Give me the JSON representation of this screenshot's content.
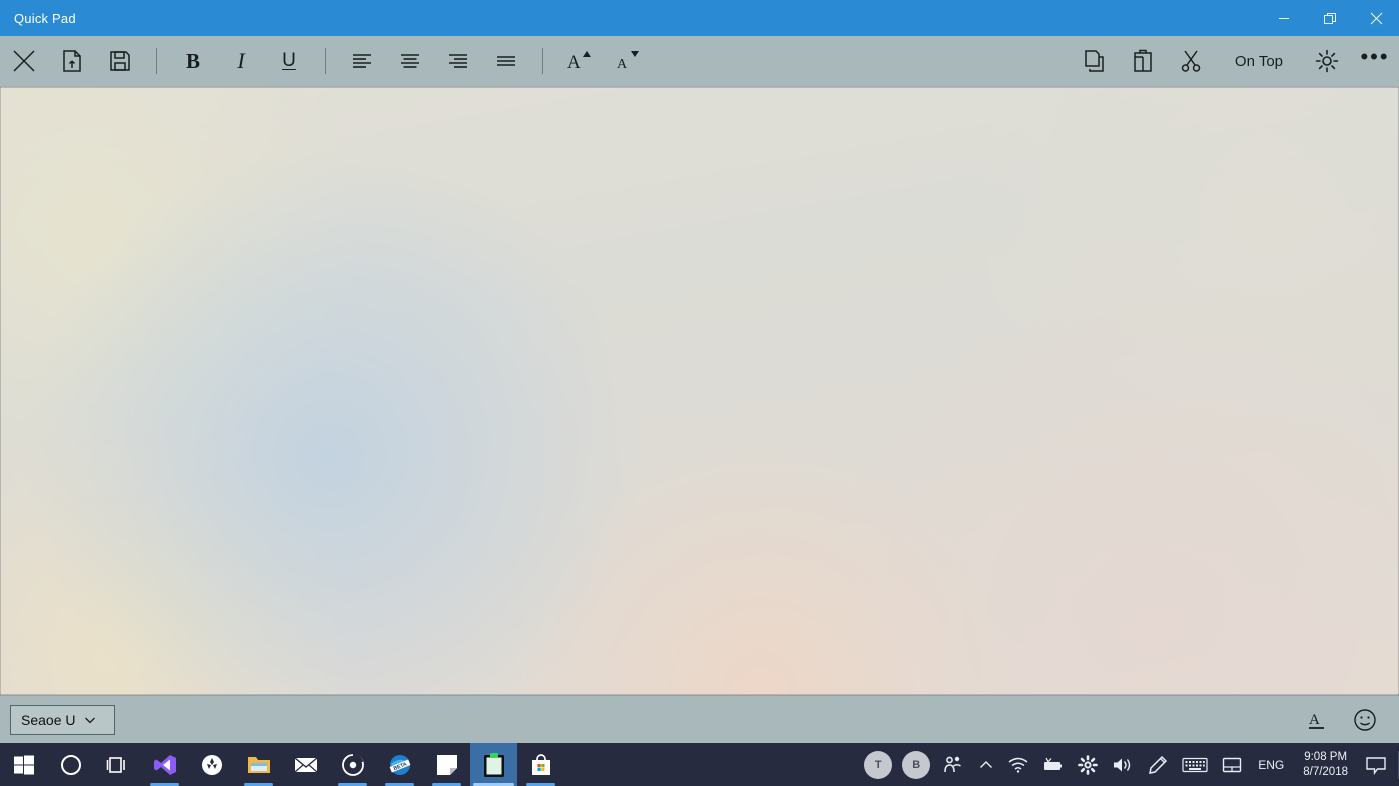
{
  "window": {
    "title": "Quick Pad",
    "accent_color": "#2a8ad4",
    "controls": [
      {
        "name": "minimize",
        "label": "Minimize"
      },
      {
        "name": "restore",
        "label": "Restore"
      },
      {
        "name": "close",
        "label": "Close"
      }
    ]
  },
  "toolbar": {
    "close_label": "Close",
    "new_label": "New",
    "save_label": "Save",
    "bold_label": "B",
    "italic_label": "I",
    "underline_label": "U",
    "align_left_label": "Align left",
    "align_center_label": "Align center",
    "align_right_label": "Align right",
    "align_justify_label": "Justify",
    "font_grow_label": "A",
    "font_shrink_label": "A",
    "copy_label": "Copy",
    "paste_label": "Paste",
    "cut_label": "Cut",
    "on_top_label": "On Top",
    "settings_label": "Settings",
    "more_label": "•••"
  },
  "editor": {
    "content": "",
    "placeholder": ""
  },
  "statusbar": {
    "font_family_value": "Seaoe U",
    "font_color_label": "Font color",
    "emoji_label": "Emoji"
  },
  "taskbar": {
    "apps": [
      {
        "name": "start",
        "label": "Start",
        "running": false,
        "active": false
      },
      {
        "name": "cortana",
        "label": "Cortana",
        "running": false,
        "active": false
      },
      {
        "name": "task-view",
        "label": "Task View",
        "running": false,
        "active": false
      },
      {
        "name": "visual-studio",
        "label": "Visual Studio",
        "running": true,
        "active": false
      },
      {
        "name": "app-circle",
        "label": "App",
        "running": false,
        "active": false
      },
      {
        "name": "file-explorer",
        "label": "File Explorer",
        "running": true,
        "active": false
      },
      {
        "name": "mail",
        "label": "Mail",
        "running": false,
        "active": false
      },
      {
        "name": "groove-music",
        "label": "Groove Music",
        "running": true,
        "active": false
      },
      {
        "name": "edge-beta",
        "label": "Edge BETA",
        "running": true,
        "active": false
      },
      {
        "name": "sticky-notes",
        "label": "Sticky Notes",
        "running": true,
        "active": false
      },
      {
        "name": "quick-pad",
        "label": "Quick Pad",
        "running": true,
        "active": true
      },
      {
        "name": "microsoft-store",
        "label": "Microsoft Store",
        "running": true,
        "active": false
      }
    ],
    "tray": {
      "avatars": [
        {
          "initial": "T",
          "label": "T"
        },
        {
          "initial": "B",
          "label": "B"
        }
      ],
      "people_label": "People",
      "show_hidden_label": "Show hidden icons",
      "network_label": "Network",
      "battery_label": "Battery",
      "settings_label": "Settings",
      "volume_label": "Volume",
      "pen_label": "Windows Ink",
      "keyboard_label": "Touch keyboard",
      "touchpad_label": "Touchpad",
      "language": "ENG",
      "time": "9:08 PM",
      "date": "8/7/2018",
      "action_center_label": "Action Center"
    }
  }
}
